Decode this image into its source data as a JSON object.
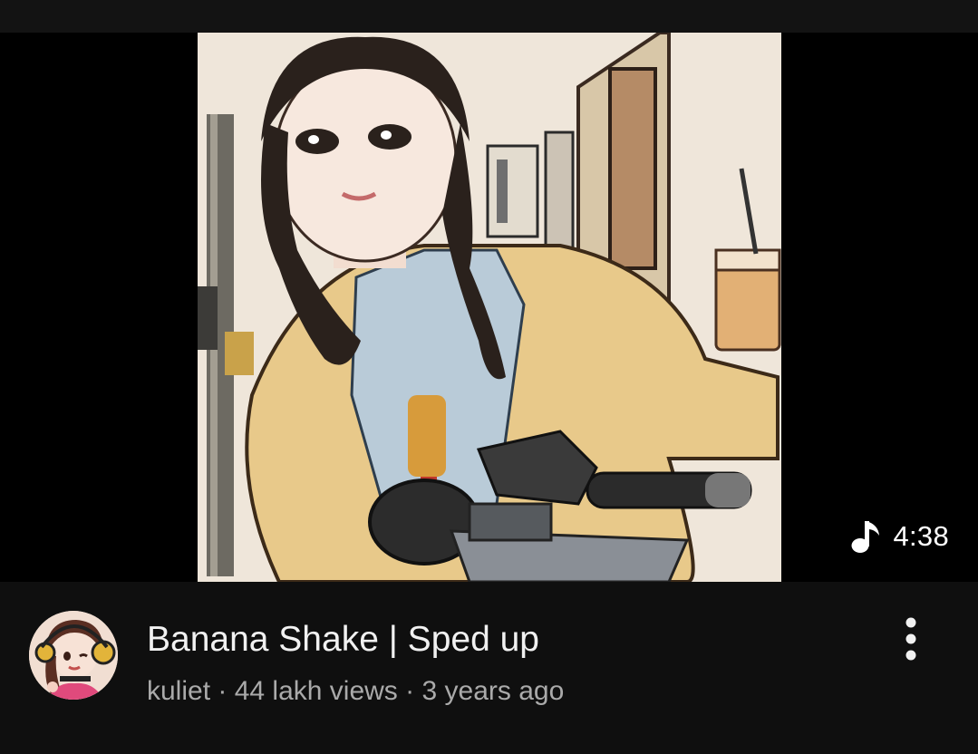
{
  "video": {
    "duration": "4:38",
    "title": "Banana Shake | Sped up",
    "channel": "kuliet",
    "views": "44 lakh views",
    "age": "3 years ago",
    "separator": " · "
  },
  "icons": {
    "duration_icon": "music-note-icon",
    "menu_icon": "more-vert-icon"
  },
  "colors": {
    "background": "#0f0f0f",
    "title_text": "#f1f1f1",
    "meta_text": "#aaaaaa"
  }
}
